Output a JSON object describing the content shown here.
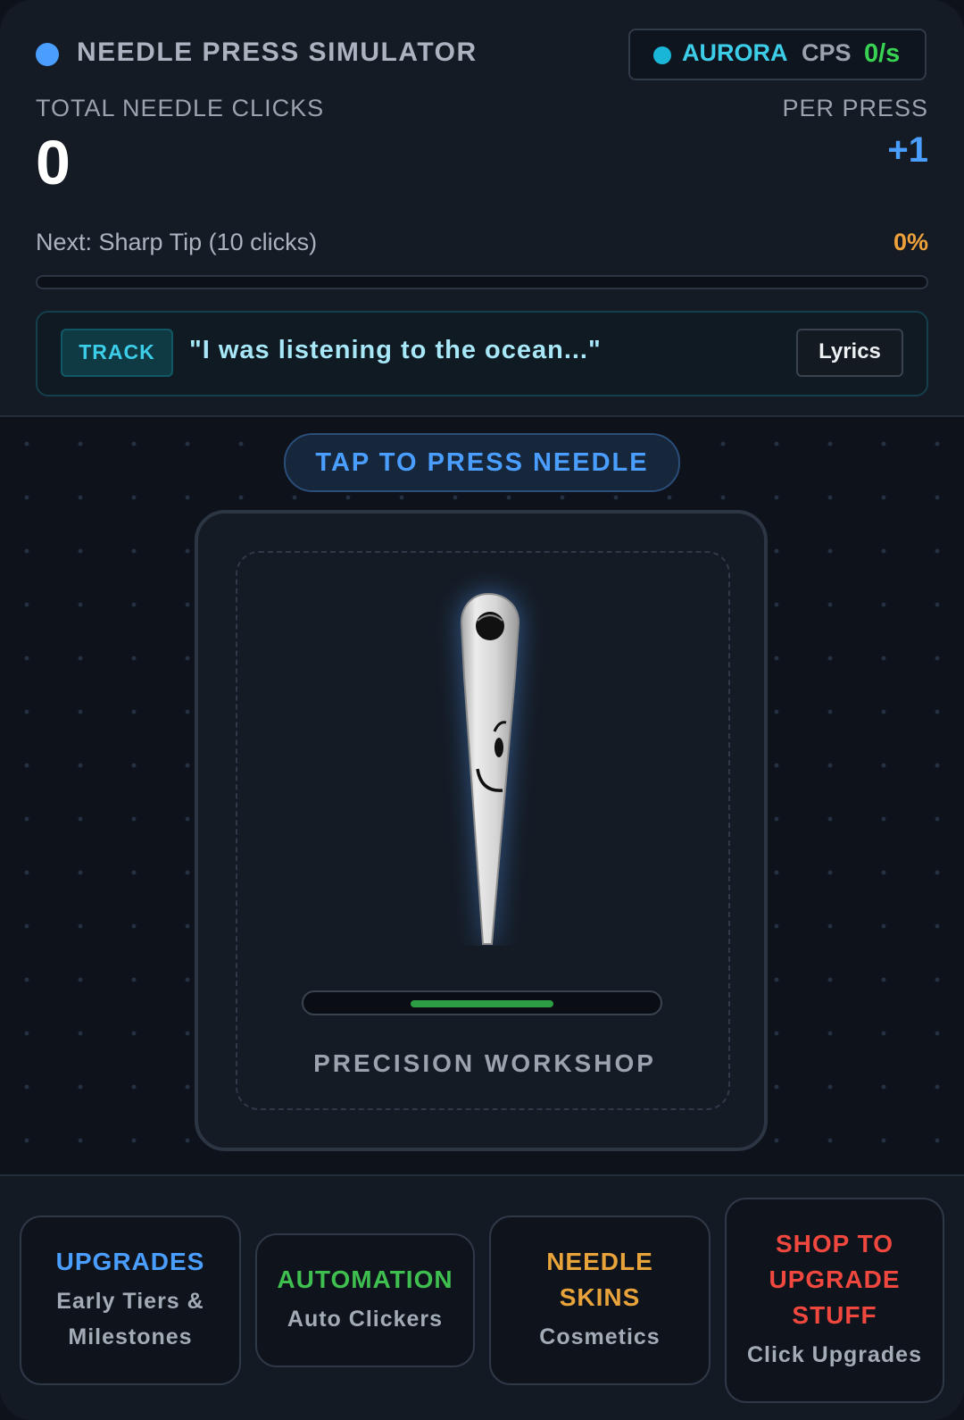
{
  "header": {
    "title": "NEEDLE PRESS SIMULATOR",
    "theme_name": "AURORA",
    "cps_label": "CPS",
    "cps_value": "0/s",
    "total_label": "TOTAL NEEDLE CLICKS",
    "total_value": "0",
    "per_press_label": "PER PRESS",
    "per_press_value": "+1",
    "next_label": "Next: Sharp Tip (10 clicks)",
    "next_percent_text": "0%",
    "next_progress": 0
  },
  "track": {
    "tag": "TRACK",
    "quote": "\"I was listening to the ocean...\"",
    "lyrics_button": "Lyrics"
  },
  "play": {
    "tap_label": "TAP TO PRESS NEEDLE",
    "workshop_label": "PRECISION WORKSHOP",
    "charge_fill_start": 0.3,
    "charge_fill_end": 0.7
  },
  "nav": [
    {
      "title": "UPGRADES",
      "subtitle": "Early Tiers & Milestones",
      "color": "#4a9eff"
    },
    {
      "title": "AUTOMATION",
      "subtitle": "Auto Clickers",
      "color": "#3fbf4f"
    },
    {
      "title": "NEEDLE SKINS",
      "subtitle": "Cosmetics",
      "color": "#e8a33a"
    },
    {
      "title": "SHOP TO UPGRADE STUFF",
      "subtitle": "Click Upgrades",
      "color": "#f0473e"
    }
  ],
  "colors": {
    "accent_blue": "#4a9eff",
    "accent_cyan": "#3ccde8",
    "accent_green": "#39d353",
    "accent_orange": "#f0a23a"
  }
}
